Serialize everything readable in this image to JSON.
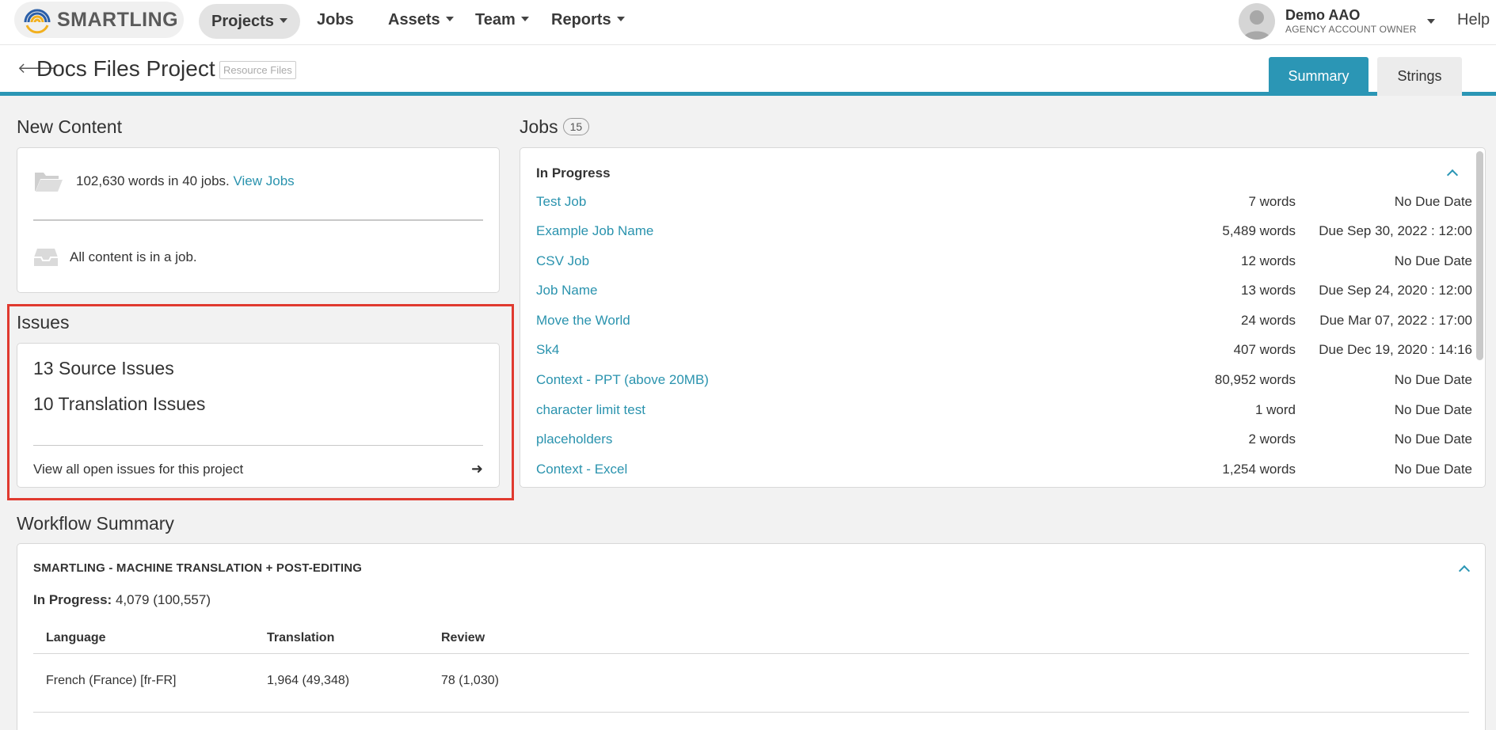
{
  "nav": {
    "logo_text": "SMARTLING",
    "items": [
      {
        "label": "Projects"
      },
      {
        "label": "Jobs"
      },
      {
        "label": "Assets"
      },
      {
        "label": "Team"
      },
      {
        "label": "Reports"
      }
    ],
    "user": {
      "name": "Demo AAO",
      "role": "AGENCY ACCOUNT OWNER"
    },
    "help_label": "Help"
  },
  "header": {
    "title": "Docs Files Project",
    "tag": "Resource Files",
    "tabs": [
      {
        "label": "Summary",
        "active": true
      },
      {
        "label": "Strings",
        "active": false
      }
    ]
  },
  "new_content": {
    "title": "New Content",
    "words_text": "102,630 words in 40 jobs.",
    "view_jobs_label": "View Jobs",
    "all_content_text": "All content is in a job."
  },
  "issues": {
    "title": "Issues",
    "source_issues": "13 Source Issues",
    "translation_issues": "10 Translation Issues",
    "view_all_label": "View all open issues for this project"
  },
  "jobs": {
    "title": "Jobs",
    "count": "15",
    "group_label": "In Progress",
    "rows": [
      {
        "name": "Test Job",
        "words": "7 words",
        "due": "No Due Date"
      },
      {
        "name": "Example Job Name",
        "words": "5,489 words",
        "due": "Due Sep 30, 2022 : 12:00"
      },
      {
        "name": "CSV Job",
        "words": "12 words",
        "due": "No Due Date"
      },
      {
        "name": "Job Name",
        "words": "13 words",
        "due": "Due Sep 24, 2020 : 12:00"
      },
      {
        "name": "Move the World",
        "words": "24 words",
        "due": "Due Mar 07, 2022 : 17:00"
      },
      {
        "name": "Sk4",
        "words": "407 words",
        "due": "Due Dec 19, 2020 : 14:16"
      },
      {
        "name": "Context - PPT (above 20MB)",
        "words": "80,952 words",
        "due": "No Due Date"
      },
      {
        "name": "character limit test",
        "words": "1 word",
        "due": "No Due Date"
      },
      {
        "name": "placeholders",
        "words": "2 words",
        "due": "No Due Date"
      },
      {
        "name": "Context - Excel",
        "words": "1,254 words",
        "due": "No Due Date"
      }
    ]
  },
  "workflow": {
    "title": "Workflow Summary",
    "workflow_name": "SMARTLING - MACHINE TRANSLATION + POST-EDITING",
    "in_progress_label": "In Progress:",
    "in_progress_value": "4,079 (100,557)",
    "columns": [
      "Language",
      "Translation",
      "Review"
    ],
    "rows": [
      {
        "language": "French (France) [fr-FR]",
        "translation": "1,964  (49,348)",
        "review": "78  (1,030)"
      }
    ]
  },
  "colors": {
    "accent": "#2b96b5",
    "link": "#2a93ae",
    "highlight": "#e03a2f"
  }
}
